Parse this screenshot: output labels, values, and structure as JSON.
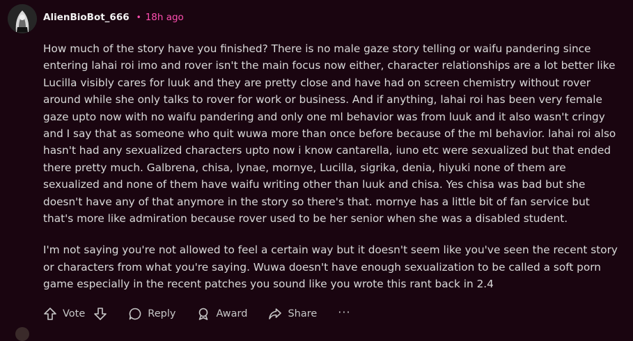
{
  "comment": {
    "username": "AlienBioBot_666",
    "separator": "•",
    "time": "18h ago",
    "paragraphs": [
      "How much of the story have you finished? There is no male gaze story telling or waifu pandering since entering lahai roi imo and rover isn't the main focus now either, character relationships are a lot better like Lucilla visibly cares for luuk and they are pretty close and have had on screen chemistry without rover around while she only talks to rover for work or business. And if anything, lahai roi has been very female gaze upto now with no waifu pandering and only one ml behavior was from luuk and it also wasn't cringy and I say that as someone who quit wuwa more than once before because of the ml behavior. lahai roi also hasn't had any sexualized characters upto now i know cantarella, iuno etc were sexualized but that ended there pretty much. Galbrena, chisa, lynae, mornye, Lucilla, sigrika, denia, hiyuki none of them are sexualized and none of them have waifu writing other than luuk and chisa. Yes chisa was bad but she doesn't have any of that anymore in the story so there's that. mornye has a little bit of fan service but that's more like admiration because rover used to be her senior when she was a disabled student.",
      "I'm not saying you're not allowed to feel a certain way but it doesn't seem like you've seen the recent story or characters from what you're saying. Wuwa doesn't have enough sexualization to be called a soft porn game especially in the recent patches you sound like you wrote this rant back in 2.4"
    ]
  },
  "actions": {
    "vote": "Vote",
    "reply": "Reply",
    "award": "Award",
    "share": "Share",
    "more": "···"
  },
  "colors": {
    "background": "#1a0510",
    "accent": "#ff4fb0",
    "text": "#d9d9d9"
  }
}
